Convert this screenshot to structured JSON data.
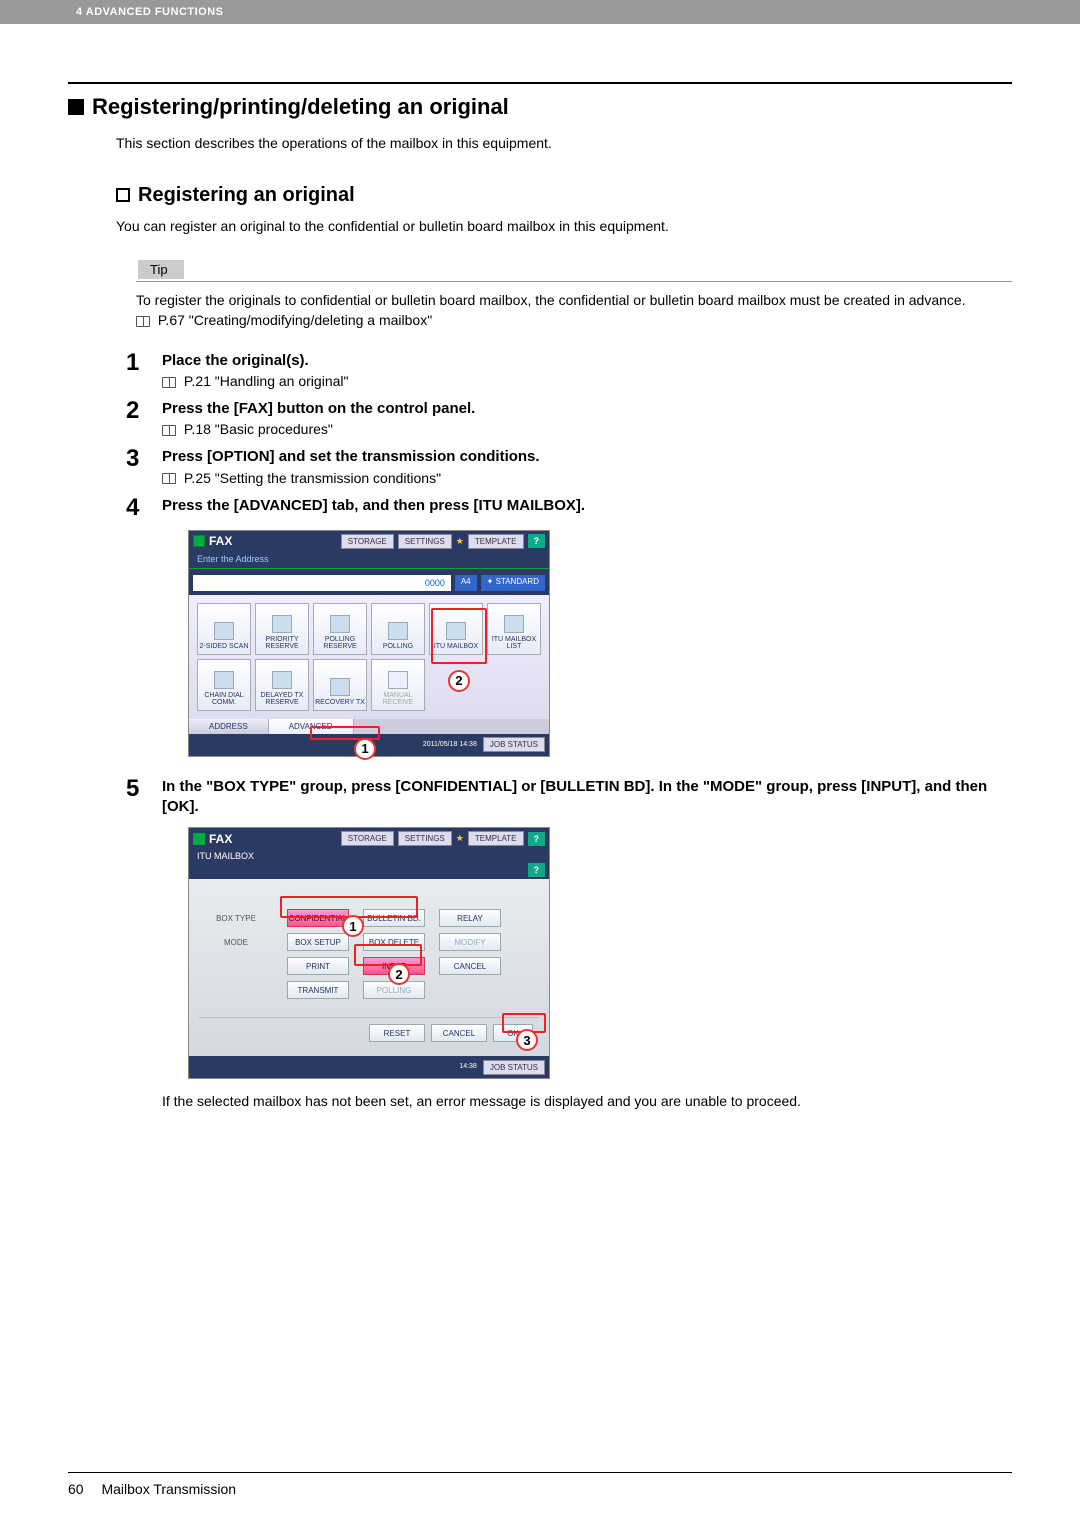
{
  "header": {
    "breadcrumb": "4 ADVANCED FUNCTIONS"
  },
  "section": {
    "h1": "Registering/printing/deleting an original",
    "intro": "This section describes the operations of the mailbox in this equipment.",
    "h2": "Registering an original",
    "h2_intro": "You can register an original to the confidential or bulletin board mailbox in this equipment."
  },
  "tip": {
    "label": "Tip",
    "text": "To register the originals to confidential or bulletin board mailbox, the confidential or bulletin board mailbox must be created in advance.",
    "ref": " P.67 \"Creating/modifying/deleting a mailbox\""
  },
  "steps": [
    {
      "n": "1",
      "title": "Place the original(s).",
      "ref": " P.21 \"Handling an original\""
    },
    {
      "n": "2",
      "title": "Press the [FAX] button on the control panel.",
      "ref": " P.18 \"Basic procedures\""
    },
    {
      "n": "3",
      "title": "Press [OPTION] and set the transmission conditions.",
      "ref": " P.25 \"Setting the transmission conditions\""
    },
    {
      "n": "4",
      "title": "Press the [ADVANCED] tab, and then press [ITU MAILBOX]."
    },
    {
      "n": "5",
      "title": "In the \"BOX TYPE\" group, press [CONFIDENTIAL] or [BULLETIN BD]. In the \"MODE\" group, press [INPUT], and then [OK]."
    }
  ],
  "step5_after": "If the selected mailbox has not been set, an error message is displayed and you are unable to proceed.",
  "fax1": {
    "title": "FAX",
    "storage": "STORAGE",
    "settings": "SETTINGS",
    "template": "TEMPLATE",
    "subtitle": "Enter the Address",
    "counter": "0000",
    "paper": "A4",
    "standard": "STANDARD",
    "cells": [
      "2-SIDED SCAN",
      "PRIORITY RESERVE",
      "POLLING RESERVE",
      "POLLING",
      "ITU MAILBOX",
      "ITU MAILBOX LIST",
      "CHAIN DIAL COMM.",
      "DELAYED TX RESERVE",
      "RECOVERY TX",
      "MANUAL RECEIVE"
    ],
    "tab_address": "ADDRESS",
    "tab_advanced": "ADVANCED",
    "jobstatus": "JOB STATUS",
    "date": "2011/05/18\n14:38"
  },
  "fax2": {
    "title": "FAX",
    "subtitle": "ITU MAILBOX",
    "storage": "STORAGE",
    "settings": "SETTINGS",
    "template": "TEMPLATE",
    "boxtype_label": "BOX TYPE",
    "mode_label": "MODE",
    "btns_row1": [
      "CONFIDENTIAL",
      "BULLETIN BD.",
      "RELAY"
    ],
    "btns_row2": [
      "BOX SETUP",
      "BOX DELETE",
      "MODIFY"
    ],
    "btns_row3": [
      "PRINT",
      "INPUT",
      "CANCEL"
    ],
    "btns_row4": [
      "TRANSMIT",
      "POLLING"
    ],
    "reset": "RESET",
    "cancel": "CANCEL",
    "ok": "OK",
    "jobstatus": "JOB STATUS",
    "date": "14:38"
  },
  "callouts": {
    "c1": "1",
    "c2": "2",
    "c3": "3"
  },
  "footer": {
    "page": "60",
    "title": "Mailbox Transmission"
  }
}
